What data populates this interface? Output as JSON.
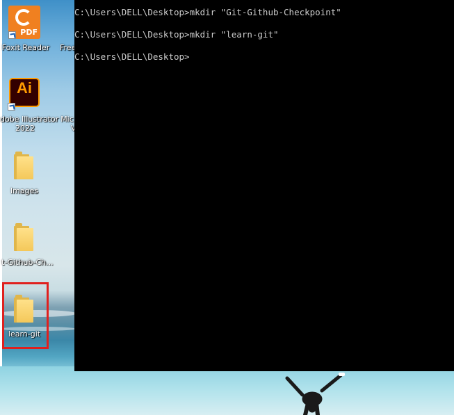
{
  "desktop": {
    "icons": [
      {
        "label": "Foxit Reader",
        "type": "pdf-app",
        "shortcut": true
      },
      {
        "label": "Free",
        "type": "partial"
      },
      {
        "label_line1": "dobe Illustrator",
        "label_line2": "2022",
        "type": "illustrator-app",
        "tile_text": "Ai",
        "shortcut": true
      },
      {
        "label_line1": "Mic",
        "label_line2": "V",
        "type": "partial"
      },
      {
        "label": "Images",
        "type": "folder"
      },
      {
        "label": "t-Github-Ch...",
        "type": "folder"
      },
      {
        "label": "learn-git",
        "type": "folder",
        "highlighted": true
      }
    ],
    "pdf_tile_text": "PDF",
    "highlight_color": "#e0201e"
  },
  "terminal": {
    "lines": [
      "C:\\Users\\DELL\\Desktop>mkdir \"Git-Github-Checkpoint\"",
      "C:\\Users\\DELL\\Desktop>mkdir \"learn-git\"",
      "C:\\Users\\DELL\\Desktop>"
    ],
    "background": "#000000",
    "foreground": "#cccccc"
  }
}
